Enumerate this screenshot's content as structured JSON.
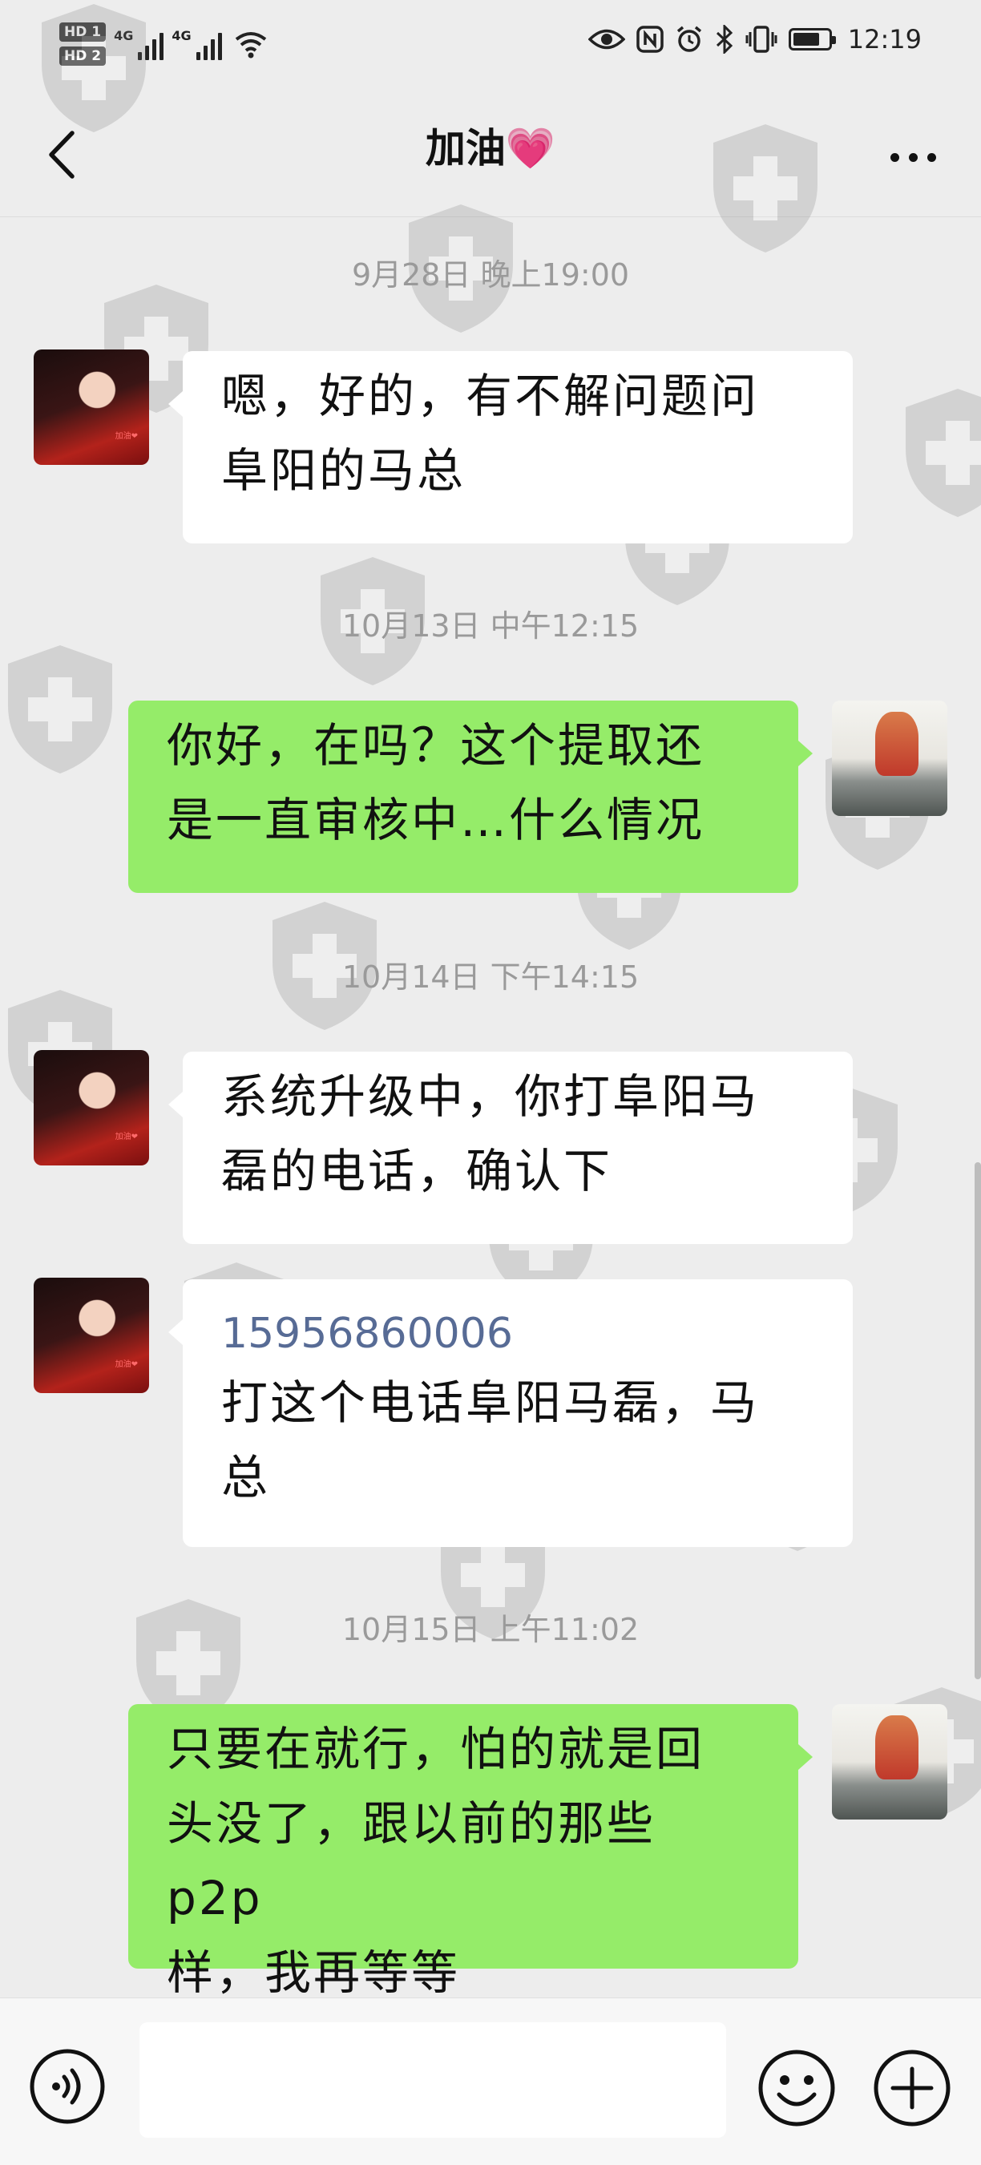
{
  "status_bar": {
    "hd1": "HD 1",
    "hd2": "HD 2",
    "net1": "4G",
    "net2": "4G",
    "time": "12:19"
  },
  "header": {
    "title": "加油"
  },
  "messages": [
    {
      "timestamp": "9月28日 晚上19:00",
      "side": "in",
      "lines": [
        "嗯，好的，有不解问题问",
        "阜阳的马总"
      ]
    },
    {
      "timestamp": "10月13日 中午12:15",
      "side": "out",
      "lines": [
        "你好，在吗？这个提取还",
        "是一直审核中…什么情况"
      ]
    },
    {
      "timestamp": "10月14日 下午14:15",
      "side": "in",
      "lines": [
        "系统升级中，你打阜阳马",
        "磊的电话，确认下"
      ]
    },
    {
      "side": "in",
      "phone": "15956860006",
      "lines": [
        "打这个电话阜阳马磊，马",
        "总"
      ]
    },
    {
      "timestamp": "10月15日 上午11:02",
      "side": "out",
      "lines": [
        "只要在就行，怕的就是回",
        "头没了，跟以前的那些 p2p",
        "样，我再等等"
      ]
    }
  ],
  "avatar_text": {
    "contact_caption": "加油❤"
  },
  "input": {
    "placeholder": ""
  },
  "icons": [
    "back-arrow-icon",
    "more-icon",
    "voice-icon",
    "emoji-icon",
    "plus-icon",
    "wifi-icon",
    "eye-icon",
    "nfc-icon",
    "alarm-icon",
    "bluetooth-icon",
    "vibrate-icon",
    "battery-icon"
  ]
}
